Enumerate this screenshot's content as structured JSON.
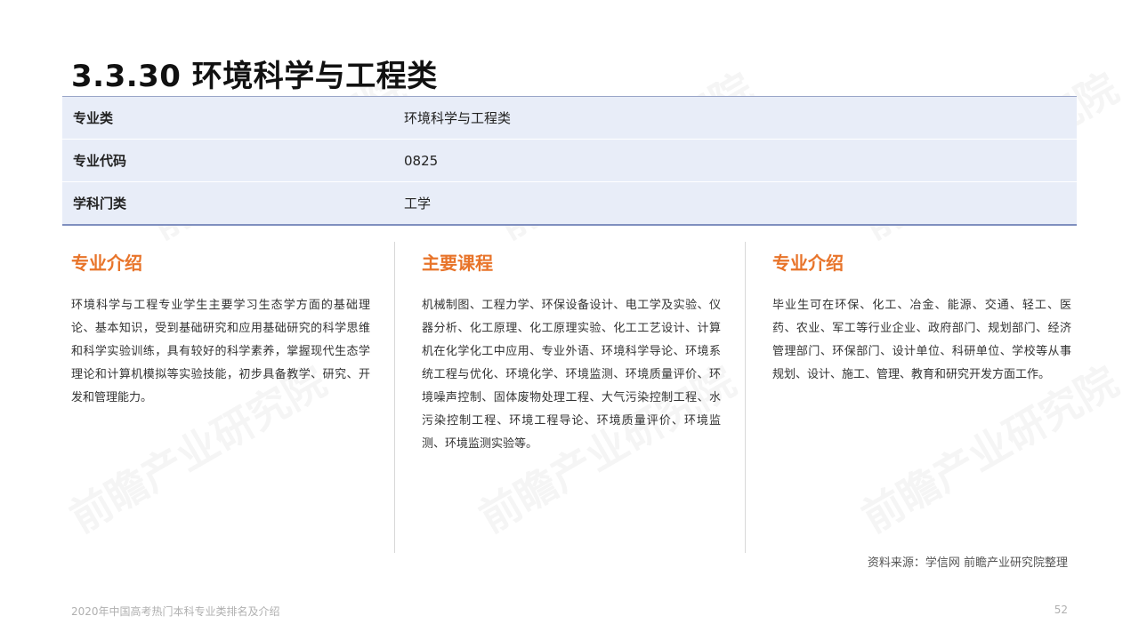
{
  "title": "3.3.30 环境科学与工程类",
  "info_table": [
    {
      "label": "专业类",
      "value": "环境科学与工程类"
    },
    {
      "label": "专业代码",
      "value": "0825"
    },
    {
      "label": "学科门类",
      "value": "工学"
    }
  ],
  "columns": [
    {
      "heading": "专业介绍",
      "body": "环境科学与工程专业学生主要学习生态学方面的基础理论、基本知识，受到基础研究和应用基础研究的科学思维和科学实验训练，具有较好的科学素养，掌握现代生态学理论和计算机模拟等实验技能，初步具备教学、研究、开发和管理能力。"
    },
    {
      "heading": "主要课程",
      "body": "机械制图、工程力学、环保设备设计、电工学及实验、仪器分析、化工原理、化工原理实验、化工工艺设计、计算机在化学化工中应用、专业外语、环境科学导论、环境系统工程与优化、环境化学、环境监测、环境质量评价、环境噪声控制、固体废物处理工程、大气污染控制工程、水污染控制工程、环境工程导论、环境质量评价、环境监测、环境监测实验等。"
    },
    {
      "heading": "专业介绍",
      "body": "毕业生可在环保、化工、冶金、能源、交通、轻工、医药、农业、军工等行业企业、政府部门、规划部门、经济管理部门、环保部门、设计单位、科研单位、学校等从事规划、设计、施工、管理、教育和研究开发方面工作。"
    }
  ],
  "source": "资料来源：学信网 前瞻产业研究院整理",
  "footer": {
    "left": "2020年中国高考热门本科专业类排名及介绍",
    "page_number": "52"
  },
  "watermark_text": "前瞻产业研究院",
  "colors": {
    "accent": "#e8742a",
    "table_bg": "#e8edf8",
    "table_border": "#7f8fbf"
  }
}
